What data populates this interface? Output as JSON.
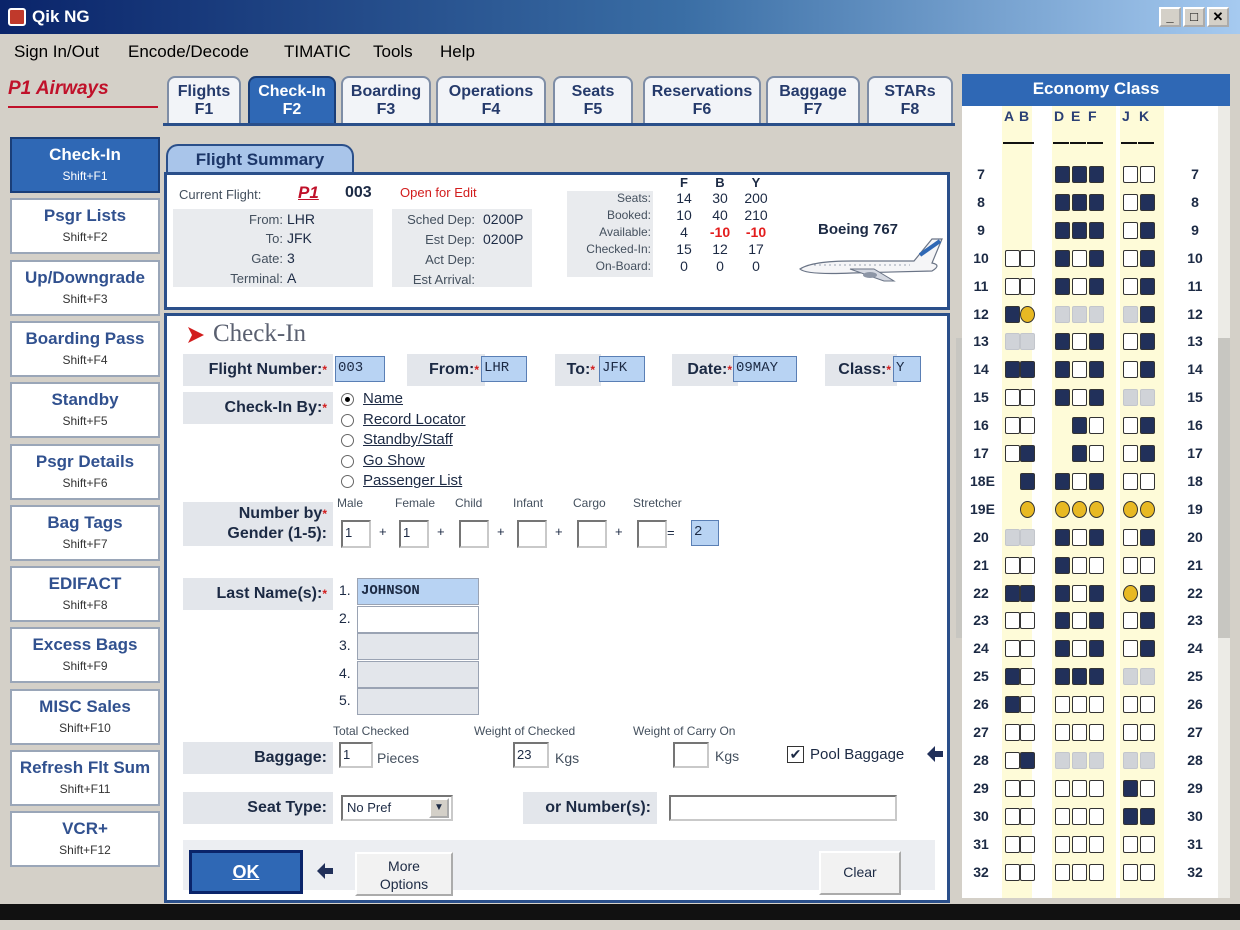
{
  "window": {
    "title": "Qik NG",
    "min": "_",
    "max": "□",
    "close": "✕"
  },
  "menu": [
    "Sign In/Out",
    "Encode/Decode",
    "TIMATIC",
    "Tools",
    "Help"
  ],
  "logo": "P1 Airways",
  "tabs": [
    {
      "l1": "Flights",
      "l2": "F1"
    },
    {
      "l1": "Check-In",
      "l2": "F2"
    },
    {
      "l1": "Boarding",
      "l2": "F3"
    },
    {
      "l1": "Operations",
      "l2": "F4"
    },
    {
      "l1": "Seats",
      "l2": "F5"
    },
    {
      "l1": "Reservations",
      "l2": "F6"
    },
    {
      "l1": "Baggage",
      "l2": "F7"
    },
    {
      "l1": "STARs",
      "l2": "F8"
    }
  ],
  "leftnav": [
    {
      "l1": "Check-In",
      "l2": "Shift+F1"
    },
    {
      "l1": "Psgr Lists",
      "l2": "Shift+F2"
    },
    {
      "l1": "Up/Downgrade",
      "l2": "Shift+F3"
    },
    {
      "l1": "Boarding Pass",
      "l2": "Shift+F4"
    },
    {
      "l1": "Standby",
      "l2": "Shift+F5"
    },
    {
      "l1": "Psgr Details",
      "l2": "Shift+F6"
    },
    {
      "l1": "Bag Tags",
      "l2": "Shift+F7"
    },
    {
      "l1": "EDIFACT",
      "l2": "Shift+F8"
    },
    {
      "l1": "Excess Bags",
      "l2": "Shift+F9"
    },
    {
      "l1": "MISC Sales",
      "l2": "Shift+F10"
    },
    {
      "l1": "Refresh Flt Sum",
      "l2": "Shift+F11"
    },
    {
      "l1": "VCR+",
      "l2": "Shift+F12"
    }
  ],
  "summary": {
    "tab_label": "Flight Summary",
    "current_flight_label": "Current Flight:",
    "airline": "P1",
    "flight_no": "003",
    "status": "Open for Edit",
    "from_label": "From:",
    "from": "LHR",
    "to_label": "To:",
    "to": "JFK",
    "gate_label": "Gate:",
    "gate": "3",
    "terminal_label": "Terminal:",
    "terminal": "A",
    "sched_dep_label": "Sched Dep:",
    "sched_dep": "0200P",
    "est_dep_label": "Est Dep:",
    "est_dep": "0200P",
    "act_dep_label": "Act Dep:",
    "act_dep": "",
    "est_arrival_label": "Est Arrival:",
    "est_arrival": "",
    "aircraft": "Boeing 767",
    "stats_cols": [
      "F",
      "B",
      "Y"
    ],
    "stats_rows": [
      {
        "label": "Seats:",
        "values": [
          "14",
          "30",
          "200"
        ]
      },
      {
        "label": "Booked:",
        "values": [
          "10",
          "40",
          "210"
        ]
      },
      {
        "label": "Available:",
        "values": [
          "4",
          "-10",
          "-10"
        ]
      },
      {
        "label": "Checked-In:",
        "values": [
          "15",
          "12",
          "17"
        ]
      },
      {
        "label": "On-Board:",
        "values": [
          "0",
          "0",
          "0"
        ]
      }
    ]
  },
  "checkin": {
    "title": "Check-In",
    "flight_number_label": "Flight Number:",
    "flight_number": "003",
    "from_label": "From:",
    "from": "LHR",
    "to_label": "To:",
    "to": "JFK",
    "date_label": "Date:",
    "date": "09MAY",
    "class_label": "Class:",
    "class": "Y",
    "checkin_by_label": "Check-In By:",
    "checkin_by_options": [
      "Name",
      "Record Locator",
      "Standby/Staff",
      "Go Show",
      "Passenger List"
    ],
    "checkin_by_selected": "Name",
    "gender_label_1": "Number by",
    "gender_label_2": "Gender (1-5):",
    "gender_cols": [
      {
        "label": "Male",
        "value": "1"
      },
      {
        "label": "Female",
        "value": "1"
      },
      {
        "label": "Child",
        "value": ""
      },
      {
        "label": "Infant",
        "value": ""
      },
      {
        "label": "Cargo",
        "value": ""
      },
      {
        "label": "Stretcher",
        "value": ""
      }
    ],
    "gender_total": "2",
    "last_names_label": "Last Name(s):",
    "last_names": [
      {
        "n": "1.",
        "v": "JOHNSON"
      },
      {
        "n": "2.",
        "v": ""
      },
      {
        "n": "3.",
        "v": ""
      },
      {
        "n": "4.",
        "v": ""
      },
      {
        "n": "5.",
        "v": ""
      }
    ],
    "baggage_label": "Baggage:",
    "total_checked_label": "Total Checked",
    "total_checked": "1",
    "pieces_label": "Pieces",
    "weight_checked_label": "Weight of Checked",
    "weight_checked": "23",
    "kgs1": "Kgs",
    "weight_carry_label": "Weight of Carry On",
    "weight_carry": "",
    "kgs2": "Kgs",
    "pool_baggage_label": "Pool Baggage",
    "pool_baggage": true,
    "seat_type_label": "Seat Type:",
    "seat_type": "No Pref",
    "or_numbers_label": "or Number(s):",
    "or_numbers": "",
    "ok": "OK",
    "more_options_1": "More",
    "more_options_2": "Options",
    "clear": "Clear"
  },
  "seatmap": {
    "title": "Economy Class",
    "columns": [
      "A",
      "B",
      "D",
      "E",
      "F",
      "J",
      "K"
    ],
    "rows": [
      "7",
      "8",
      "9",
      "10",
      "11",
      "12",
      "13",
      "14",
      "15",
      "16",
      "17",
      "18E",
      "19E",
      "20",
      "21",
      "22",
      "23",
      "24",
      "25",
      "26",
      "27",
      "28",
      "29",
      "30",
      "31",
      "32"
    ],
    "right_rows": [
      "7",
      "8",
      "9",
      "10",
      "11",
      "12",
      "13",
      "14",
      "15",
      "16",
      "17",
      "18",
      "19",
      "20",
      "21",
      "22",
      "23",
      "24",
      "25",
      "26",
      "27",
      "28",
      "29",
      "30",
      "31",
      "32"
    ]
  },
  "colors": {
    "accent": "#2f68b5",
    "brand": "#c0112a",
    "required": "#d21d1d",
    "available_negative": "#e31d1d"
  }
}
